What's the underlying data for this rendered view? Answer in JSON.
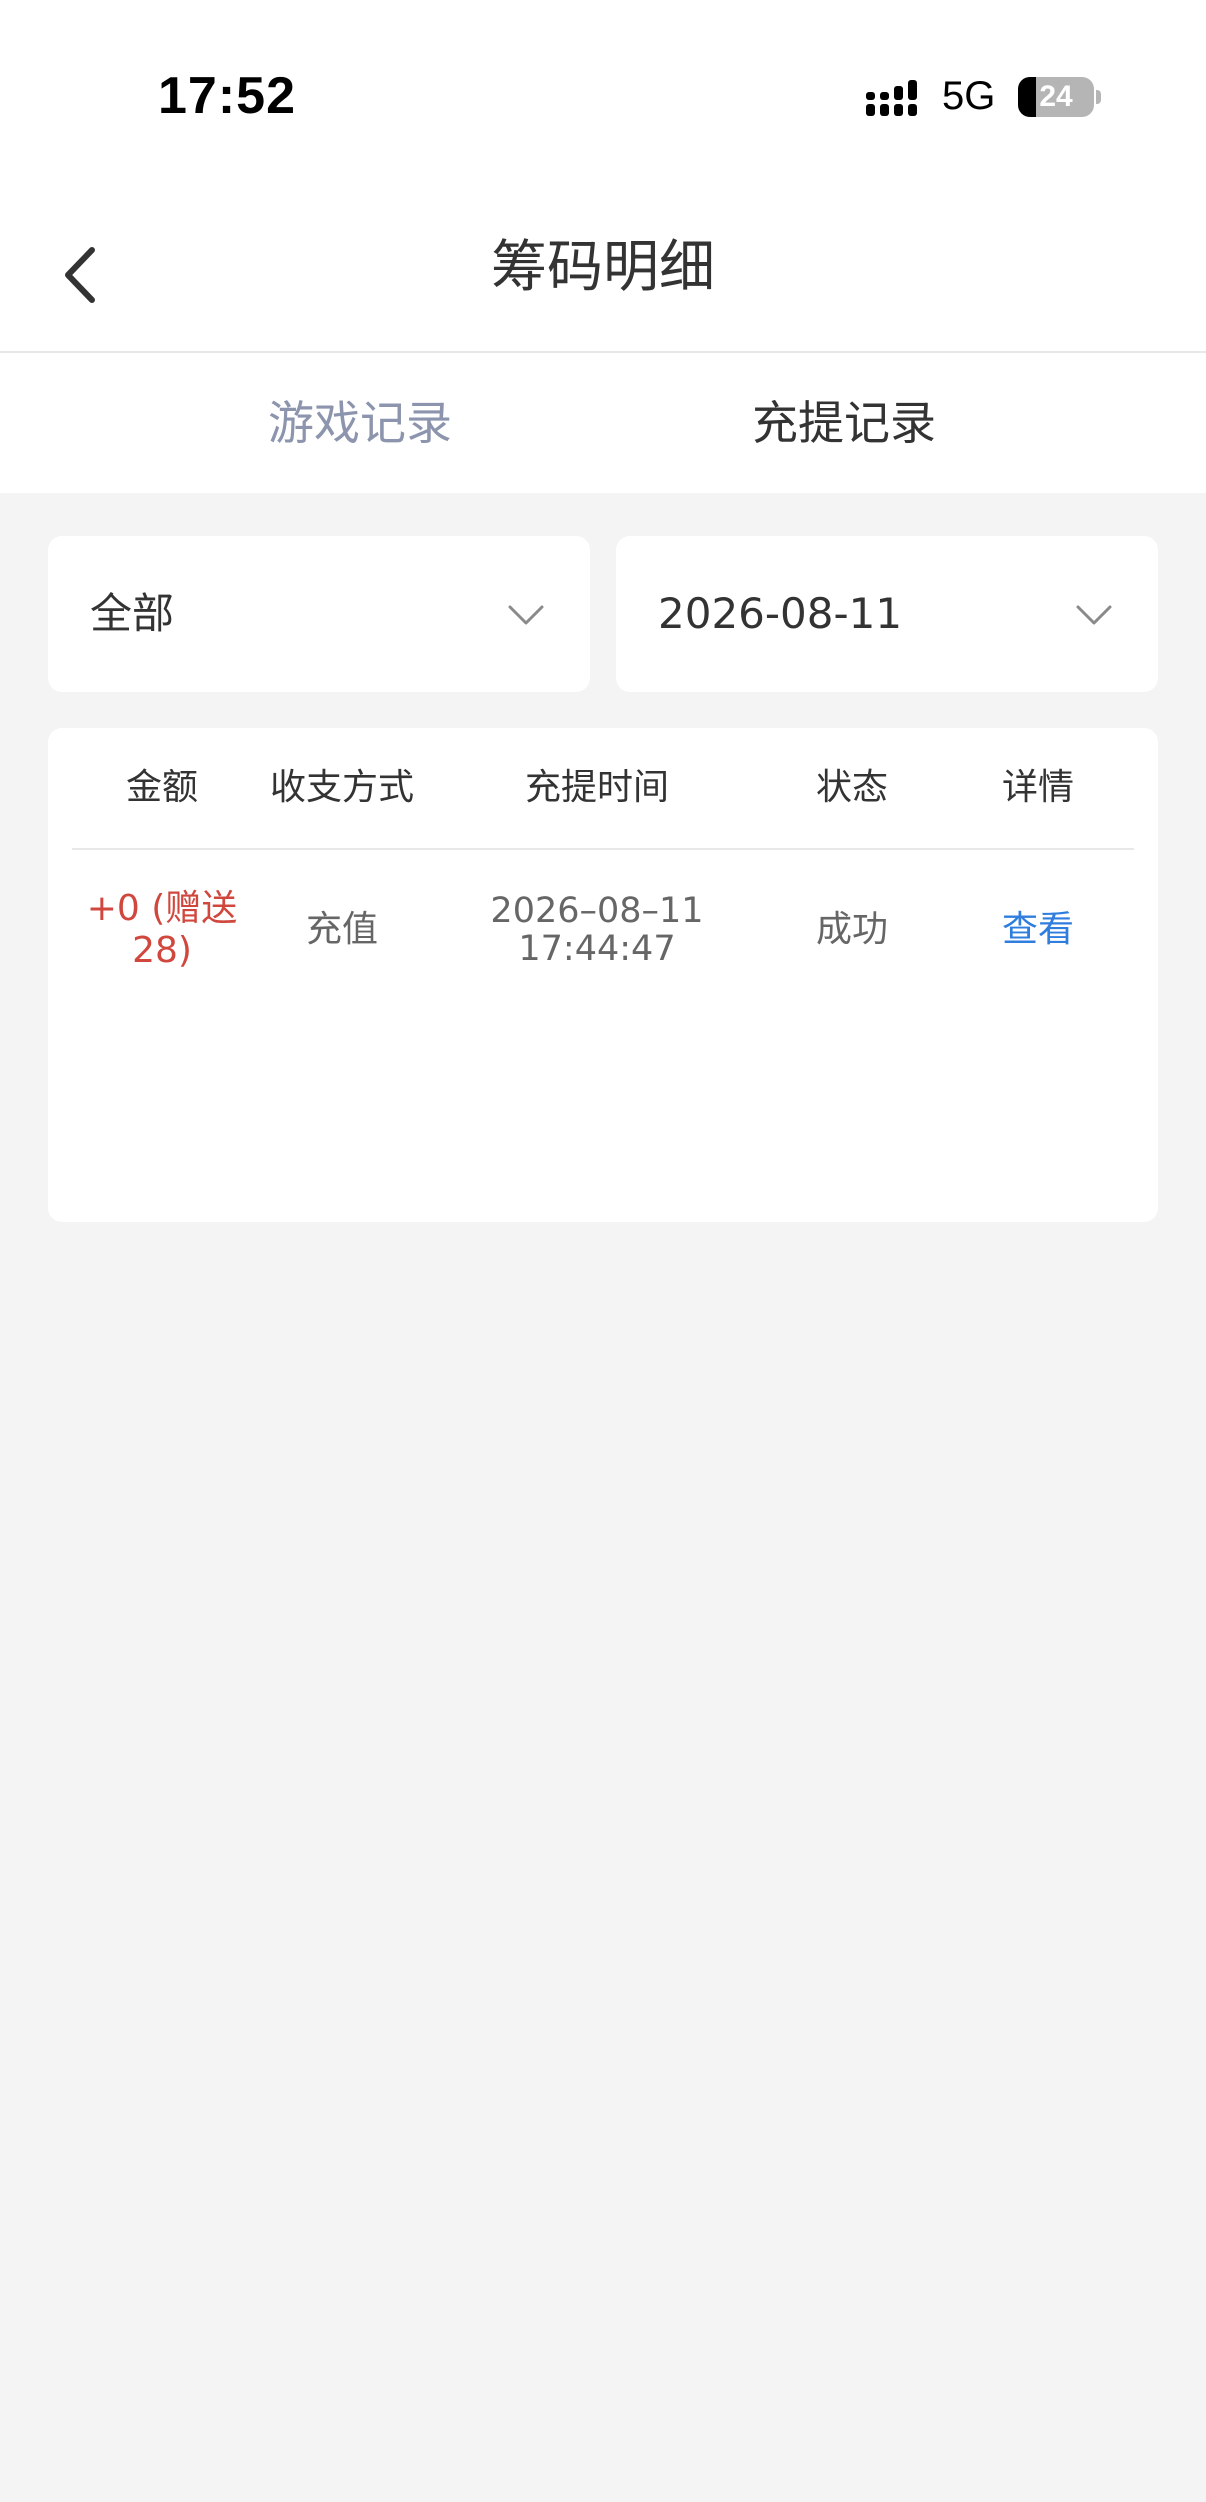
{
  "status_bar": {
    "time": "17:52",
    "network": "5G",
    "battery_level": "24",
    "battery_fraction": 0.24
  },
  "header": {
    "title": "筹码明细",
    "back_icon": "chevron-left-icon"
  },
  "tabs": [
    {
      "label": "游戏记录",
      "active": false
    },
    {
      "label": "充提记录",
      "active": true
    }
  ],
  "filters": {
    "type": {
      "value": "全部",
      "icon": "chevron-down-icon"
    },
    "date": {
      "value": "2026-08-11",
      "icon": "chevron-down-icon"
    }
  },
  "table": {
    "headers": {
      "amount": "金额",
      "method": "收支方式",
      "time": "充提时间",
      "status": "状态",
      "detail": "详情"
    },
    "rows": [
      {
        "amount": "+0 (赠送28)",
        "method": "充值",
        "date": "2026–08–11",
        "time": "17:44:47",
        "status": "成功",
        "detail": "查看"
      }
    ]
  },
  "colors": {
    "background": "#f4f4f4",
    "card": "#ffffff",
    "text_primary": "#333333",
    "text_secondary": "#666666",
    "tab_inactive": "#8c95ad",
    "amount_red": "#d0473d",
    "link_blue": "#2f7ddd"
  }
}
